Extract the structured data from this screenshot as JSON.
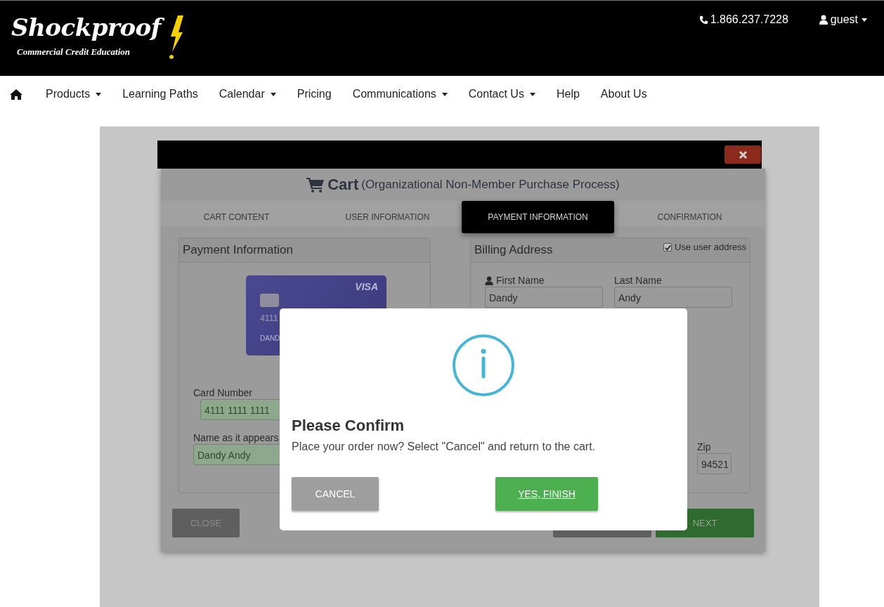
{
  "header": {
    "logo": {
      "title": "Shockproof",
      "tagline": "Commercial Credit Education"
    },
    "phone": "1.866.237.7228",
    "user": "guest"
  },
  "nav": [
    {
      "label": "Products",
      "dropdown": true
    },
    {
      "label": "Learning Paths",
      "dropdown": false
    },
    {
      "label": "Calendar",
      "dropdown": true
    },
    {
      "label": "Pricing",
      "dropdown": false
    },
    {
      "label": "Communications",
      "dropdown": true
    },
    {
      "label": "Contact Us",
      "dropdown": true
    },
    {
      "label": "Help",
      "dropdown": false
    },
    {
      "label": "About Us",
      "dropdown": false
    }
  ],
  "cart": {
    "title": "Cart",
    "subtitle": "(Organizational Non-Member Purchase Process)",
    "steps": [
      {
        "label": "CART CONTENT",
        "selected": false
      },
      {
        "label": "USER INFORMATION",
        "selected": false
      },
      {
        "label": "PAYMENT INFORMATION",
        "selected": true
      },
      {
        "label": "CONFIRMATION",
        "selected": false
      }
    ],
    "payment": {
      "heading": "Payment Information",
      "card": {
        "brand": "VISA",
        "number": "4111",
        "name": "DAND"
      },
      "fields": [
        {
          "label": "Card Number",
          "value": "4111 1111 1111"
        },
        {
          "label": "Name as it appears",
          "value": "Dandy Andy"
        }
      ]
    },
    "billing": {
      "heading": "Billing Address",
      "use_user_address": {
        "label": "Use user address",
        "checked": true
      },
      "names": [
        {
          "label": "First Name",
          "value": "Dandy",
          "has_icon": true
        },
        {
          "label": "Last Name",
          "value": "Andy",
          "has_icon": false
        }
      ],
      "zip": {
        "label": "Zip",
        "value": "94521"
      }
    },
    "buttons": [
      {
        "label": "CLOSE",
        "kind": "close"
      },
      {
        "kind": "previous"
      },
      {
        "label": "NEXT",
        "kind": "next"
      }
    ]
  },
  "dialog": {
    "title": "Please Confirm",
    "message": "Place your order now? Select \"Cancel\" and return to the cart.",
    "buttons": [
      {
        "label": "CANCEL",
        "kind": "cancel"
      },
      {
        "label": "YES, FINISH",
        "kind": "confirm"
      }
    ]
  }
}
